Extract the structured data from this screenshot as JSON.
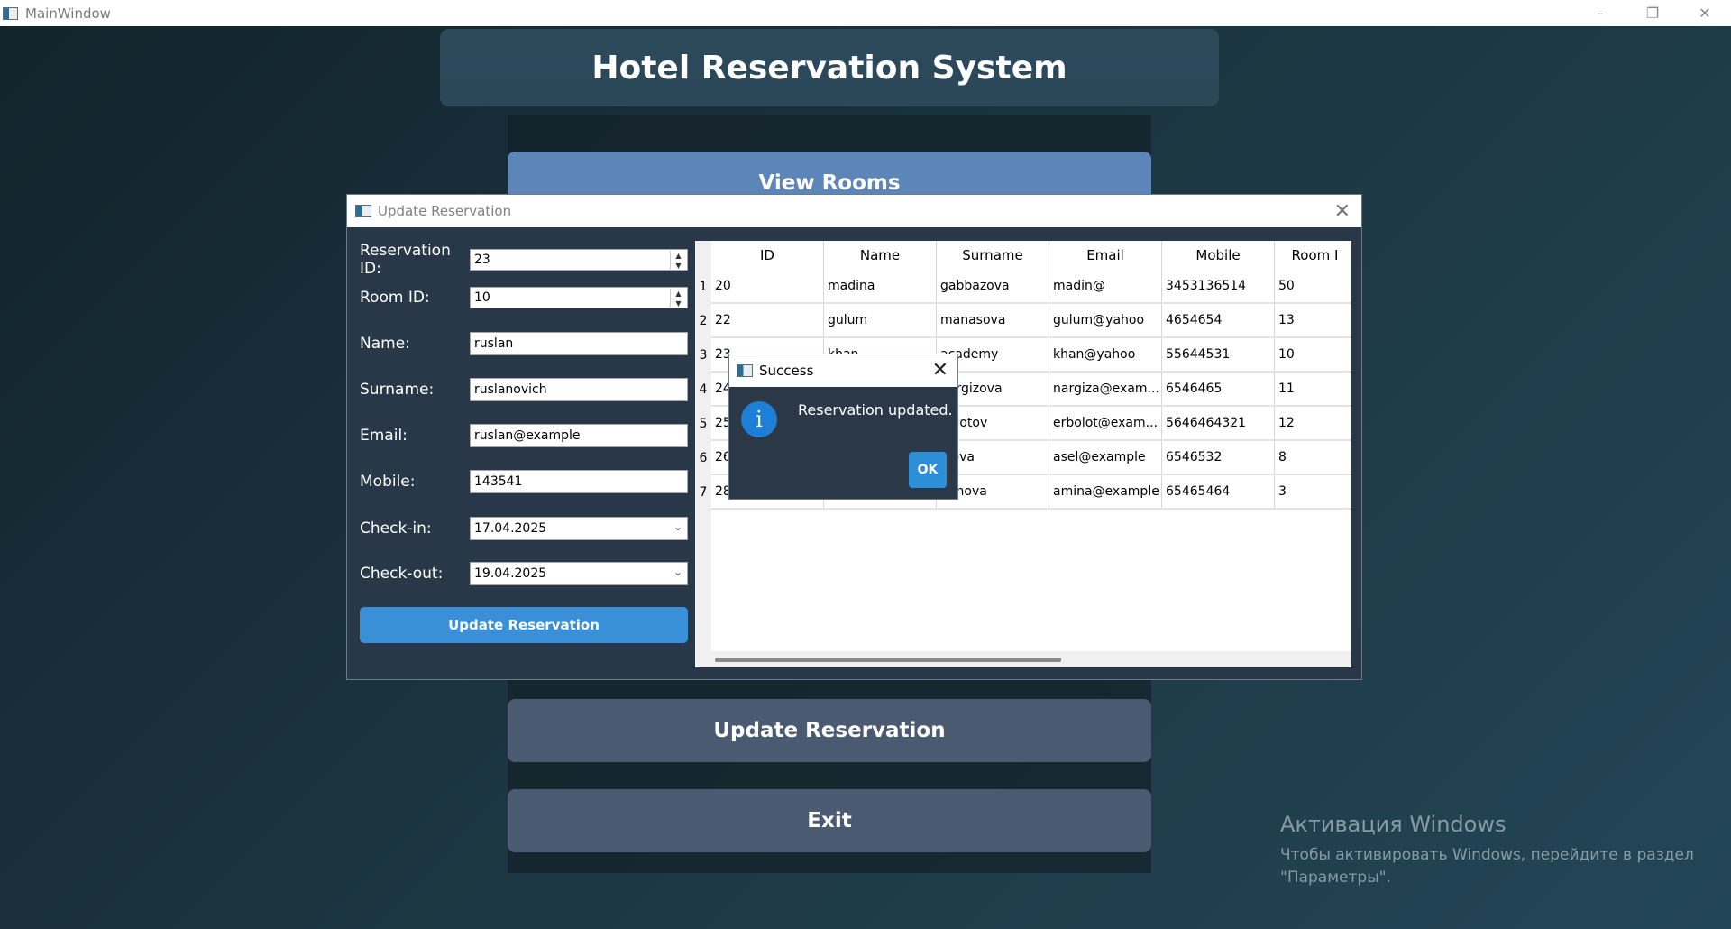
{
  "main_window": {
    "title": "MainWindow",
    "controls": {
      "minimize": "–",
      "restore": "❐",
      "close": "✕"
    },
    "header": "Hotel Reservation System",
    "buttons": {
      "view_rooms": "View Rooms",
      "update_reservation": "Update Reservation",
      "exit": "Exit"
    }
  },
  "activation": {
    "title": "Активация Windows",
    "line1": "Чтобы активировать Windows, перейдите в раздел",
    "line2": "\"Параметры\"."
  },
  "dialog": {
    "title": "Update Reservation",
    "close": "✕",
    "form": {
      "reservation_id": {
        "label": "Reservation ID:",
        "value": "23"
      },
      "room_id": {
        "label": "Room ID:",
        "value": "10"
      },
      "name": {
        "label": "Name:",
        "value": "ruslan"
      },
      "surname": {
        "label": "Surname:",
        "value": "ruslanovich"
      },
      "email": {
        "label": "Email:",
        "value": "ruslan@example"
      },
      "mobile": {
        "label": "Mobile:",
        "value": "143541"
      },
      "check_in": {
        "label": "Check-in:",
        "value": "17.04.2025"
      },
      "check_out": {
        "label": "Check-out:",
        "value": "19.04.2025"
      }
    },
    "submit_label": "Update Reservation",
    "table": {
      "columns": [
        "ID",
        "Name",
        "Surname",
        "Email",
        "Mobile",
        "Room I"
      ],
      "rows": [
        {
          "num": "1",
          "cells": [
            "20",
            "madina",
            "gabbazova",
            "madin@",
            "3453136514",
            "50"
          ]
        },
        {
          "num": "2",
          "cells": [
            "22",
            "gulum",
            "manasova",
            "gulum@yahoo",
            "4654654",
            "13"
          ]
        },
        {
          "num": "3",
          "cells": [
            "23",
            "khan",
            "academy",
            "khan@yahoo",
            "55644531",
            "10"
          ]
        },
        {
          "num": "4",
          "cells": [
            "24",
            "",
            "nargizova",
            "nargiza@exam...",
            "6546465",
            "11"
          ]
        },
        {
          "num": "5",
          "cells": [
            "25",
            "",
            "bolotov",
            "erbolot@exam...",
            "5646464321",
            "12"
          ]
        },
        {
          "num": "6",
          "cells": [
            "26",
            "",
            "elova",
            "asel@example",
            "6546532",
            "8"
          ]
        },
        {
          "num": "7",
          "cells": [
            "28",
            "",
            "minova",
            "amina@example",
            "65465464",
            "3"
          ]
        }
      ]
    }
  },
  "message_box": {
    "title": "Success",
    "close": "✕",
    "icon": "i",
    "text": "Reservation updated.",
    "ok_label": "OK"
  }
}
